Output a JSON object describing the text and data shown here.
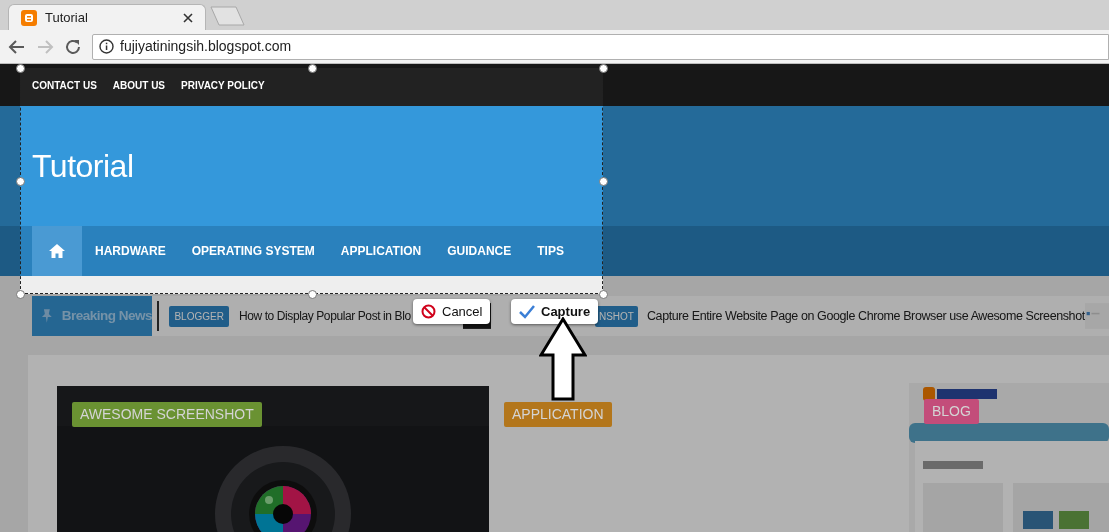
{
  "browser": {
    "tab": {
      "title": "Tutorial"
    },
    "url": "fujiyatiningsih.blogspot.com"
  },
  "top_links": [
    "CONTACT US",
    "ABOUT US",
    "PRIVACY POLICY"
  ],
  "site_title": "Tutorial",
  "nav": [
    {
      "kind": "home",
      "selected": true
    },
    {
      "kind": "link",
      "label": "HARDWARE",
      "selected": false
    },
    {
      "kind": "link",
      "label": "OPERATING SYSTEM",
      "selected": false
    },
    {
      "kind": "link",
      "label": "APPLICATION",
      "selected": false
    },
    {
      "kind": "link",
      "label": "GUIDANCE",
      "selected": false
    },
    {
      "kind": "link",
      "label": "TIPS",
      "selected": false
    }
  ],
  "breaking_news": {
    "label": "Breaking News",
    "items": [
      {
        "tag": "BLOGGER",
        "title": "How to Display Popular Post in Blo"
      },
      {
        "tag": "NSHOT",
        "title": "Capture Entire Website Page on Google Chrome Browser use Awesome Screenshot"
      }
    ]
  },
  "posts": [
    {
      "kind": "picture",
      "tag": "AWESOME SCREENSHOT",
      "color": "#6a9232"
    },
    {
      "kind": "plain",
      "tag": "APPLICATION",
      "color": "#b3761b"
    },
    {
      "kind": "picture",
      "tag": "BLOG",
      "color": "#c34d7a"
    }
  ],
  "capture_toolbar": {
    "buttons": [
      {
        "kind": "cancel",
        "label": "Cancel"
      },
      {
        "kind": "capture",
        "label": "Capture"
      }
    ]
  }
}
